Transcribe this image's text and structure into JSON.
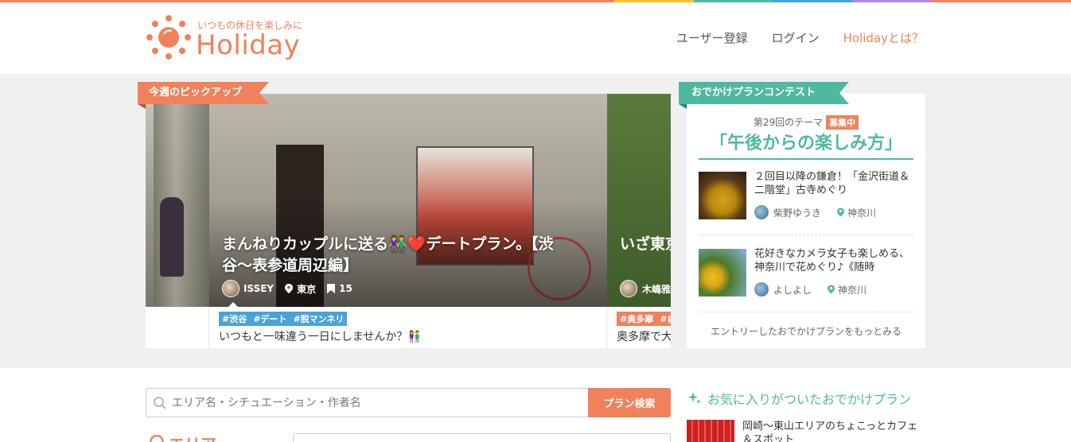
{
  "colors": {
    "accent": "#f0815b",
    "teal": "#4fb9a0",
    "tag_blue": "#4aa3d8"
  },
  "header": {
    "tagline": "いつもの休日を楽しみに",
    "brand": "Holiday",
    "nav": {
      "register": "ユーザー登録",
      "login": "ログイン",
      "about": "Holidayとは？"
    }
  },
  "pickup": {
    "label": "今週のピックアップ",
    "main": {
      "title": "まんねりカップルに送る👫❤️デートプラン。【渋谷〜表参道周辺編】",
      "author": "ISSEY",
      "location": "東京",
      "bookmarks": "15",
      "tags": [
        "#渋谷",
        "#デート",
        "#脱マンネリ"
      ],
      "description": "いつもと一味違う一日にしませんか？👫"
    },
    "next": {
      "title": "いざ東京サイクリングへ",
      "author": "木嶋雅",
      "tags": [
        "#奥多摩",
        "#自然"
      ],
      "description": "奥多摩で大"
    }
  },
  "contest": {
    "label": "おでかけプランコンテスト",
    "theme_prefix": "第29回のテーマ",
    "status_badge": "募集中",
    "theme_title": "「午後からの楽しみ方」",
    "entries": [
      {
        "title": "２回目以降の鎌倉！「金沢街道＆二階堂」古寺めぐり",
        "author": "柴野ゆうき",
        "location": "神奈川"
      },
      {
        "title": "花好きなカメラ女子も楽しめる、神奈川で花めぐり♪《随時",
        "author": "よしよし",
        "location": "神奈川"
      }
    ],
    "more_link": "エントリーしたおでかけプランをもっとみる"
  },
  "search": {
    "placeholder": "エリア名・シチュエーション・作者名",
    "button": "プラン検索"
  },
  "area": {
    "label": "エリア"
  },
  "favorites": {
    "heading": "お気に入りがついたおでかけプラン",
    "items": [
      {
        "title": "岡崎〜東山エリアのちょこっとカフェ＆スポット"
      }
    ]
  },
  "icons": [
    "sun-logo-icon",
    "location-pin-icon",
    "bookmark-icon",
    "search-icon",
    "sparkle-icon",
    "pin-outline-icon"
  ]
}
